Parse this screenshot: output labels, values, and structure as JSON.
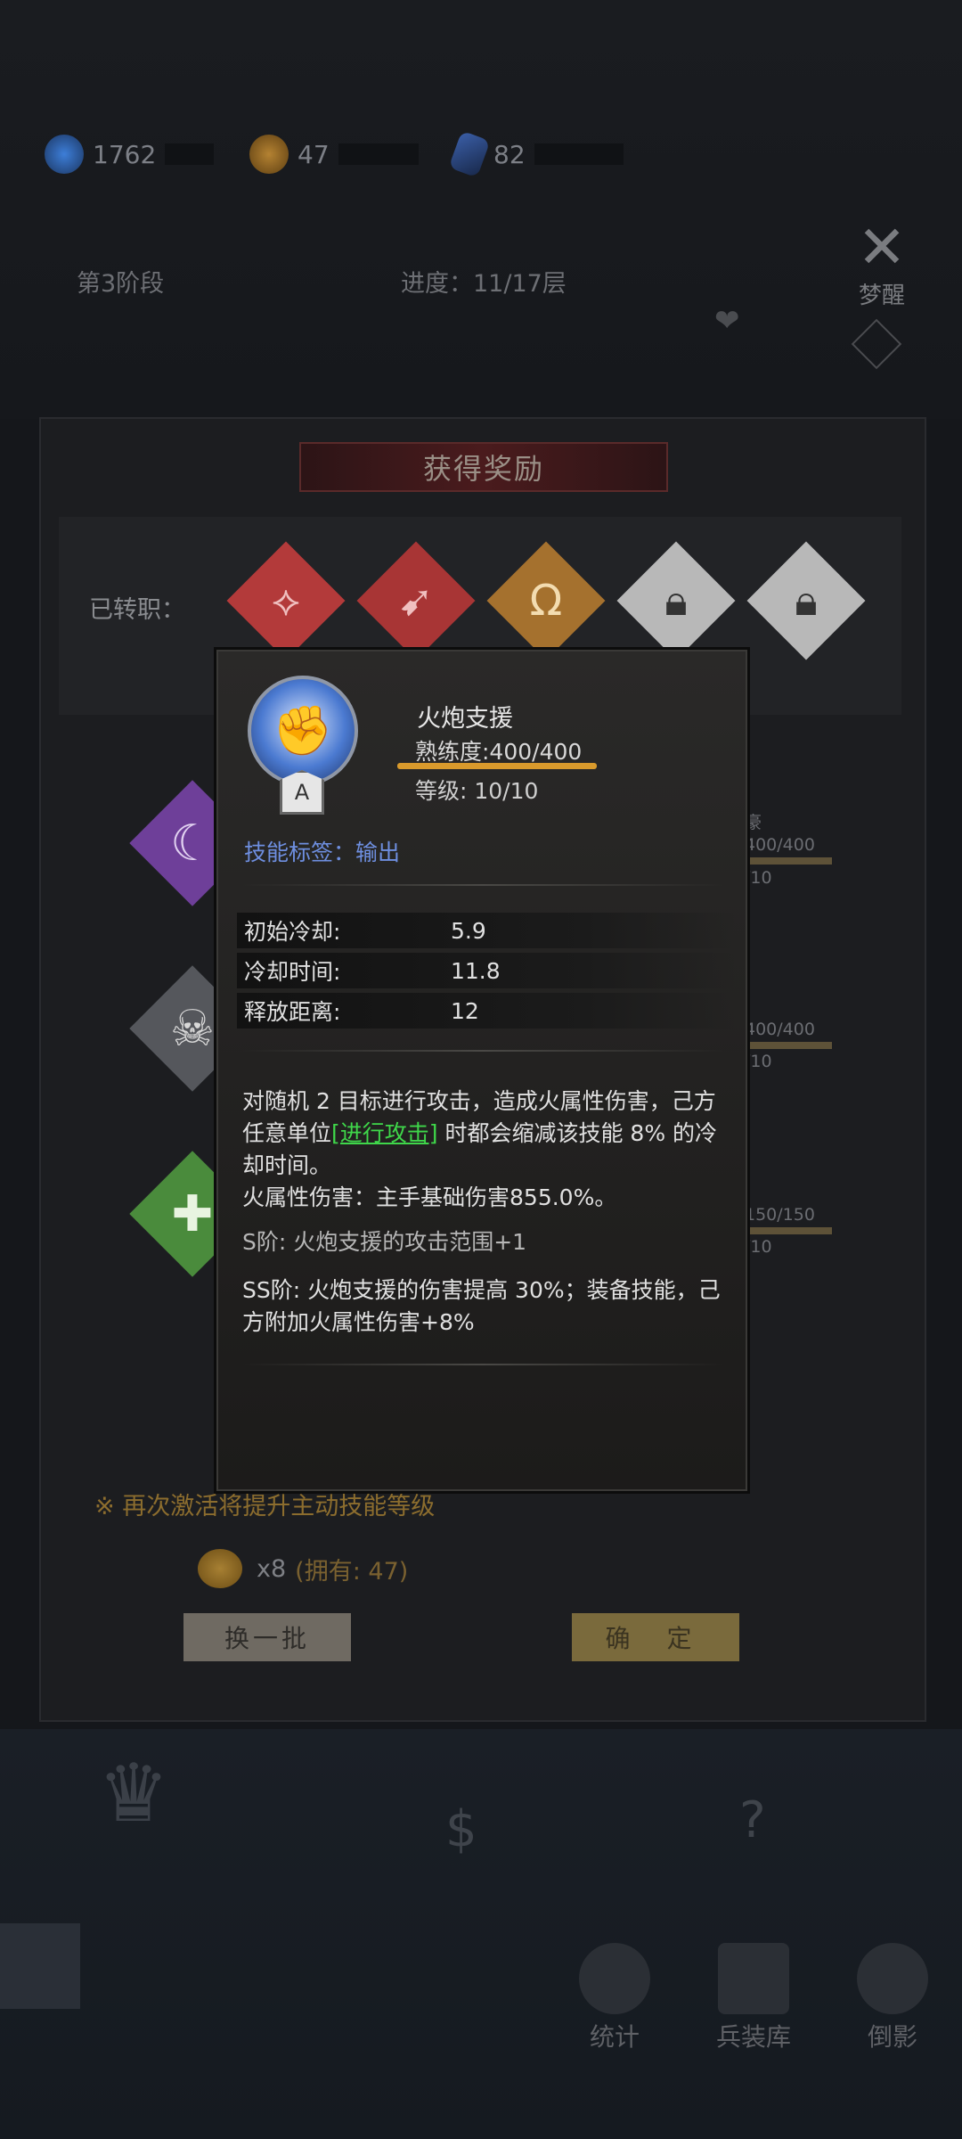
{
  "resources": [
    {
      "icon": "gem-orb-icon",
      "value": "1762",
      "color": "#3d7ed8"
    },
    {
      "icon": "gold-coin-icon",
      "value": "47",
      "color": "#b48232"
    },
    {
      "icon": "crystal-shard-icon",
      "value": "82",
      "color": "#3b5fa8"
    }
  ],
  "stage": {
    "phase": "第3阶段",
    "progress": "进度：11/17层"
  },
  "dream_button": "梦醒",
  "reward_panel": {
    "title": "获得奖励",
    "class_label": "已转职：",
    "classes": [
      {
        "icon": "spear-icon",
        "color": "#b33a3a",
        "locked": false
      },
      {
        "icon": "bow-icon",
        "color": "#a83535",
        "locked": false
      },
      {
        "icon": "horseshoe-icon",
        "color": "#a5712e",
        "locked": false
      },
      {
        "icon": "lock-icon",
        "color": "#b8b8b8",
        "locked": true
      },
      {
        "icon": "lock-icon",
        "color": "#b8b8b8",
        "locked": true
      }
    ],
    "side_items": [
      {
        "icon": "feather-moon-icon",
        "color": "#6e3f99",
        "bar_text": "400/400",
        "level_text": "/10",
        "label": "豪"
      },
      {
        "icon": "pirate-skull-icon",
        "color": "#6a6a6a",
        "bar_text": "400/400",
        "level_text": "/10"
      },
      {
        "icon": "plus-heal-icon",
        "color": "#4a8b3c",
        "bar_text": "150/150",
        "level_text": "/10"
      }
    ],
    "notice": "※ 再次激活将提升主动技能等级",
    "cost_count": "x8",
    "cost_owned": "(拥有: 47)",
    "swap_button": "换一批",
    "confirm_button": "确 定"
  },
  "bottom_nav": [
    {
      "icon": "stats-icon",
      "label": "统计"
    },
    {
      "icon": "armory-icon",
      "label": "兵装库"
    },
    {
      "icon": "shadow-icon",
      "label": "倒影"
    }
  ],
  "skill_popup": {
    "name": "火炮支援",
    "rank": "A",
    "proficiency": "熟练度:400/400",
    "proficiency_fraction": 1.0,
    "level": "等级: 10/10",
    "tag_label": "技能标签：",
    "tag_value": "输出",
    "stats": [
      {
        "label": "初始冷却:",
        "value": "5.9"
      },
      {
        "label": "冷却时间:",
        "value": "11.8"
      },
      {
        "label": "释放距离:",
        "value": "12"
      }
    ],
    "desc_pre": "对随机 2 目标进行攻击，造成火属性伤害，己方任意单位",
    "desc_link": "[进行攻击]",
    "desc_post": " 时都会缩减该技能 8% 的冷却时间。",
    "desc_damage": "火属性伤害：主手基础伤害855.0%。",
    "s_rank": "S阶: 火炮支援的攻击范围+1",
    "ss_rank": "SS阶: 火炮支援的伤害提高 30%；装备技能，己方附加火属性伤害+8%"
  }
}
